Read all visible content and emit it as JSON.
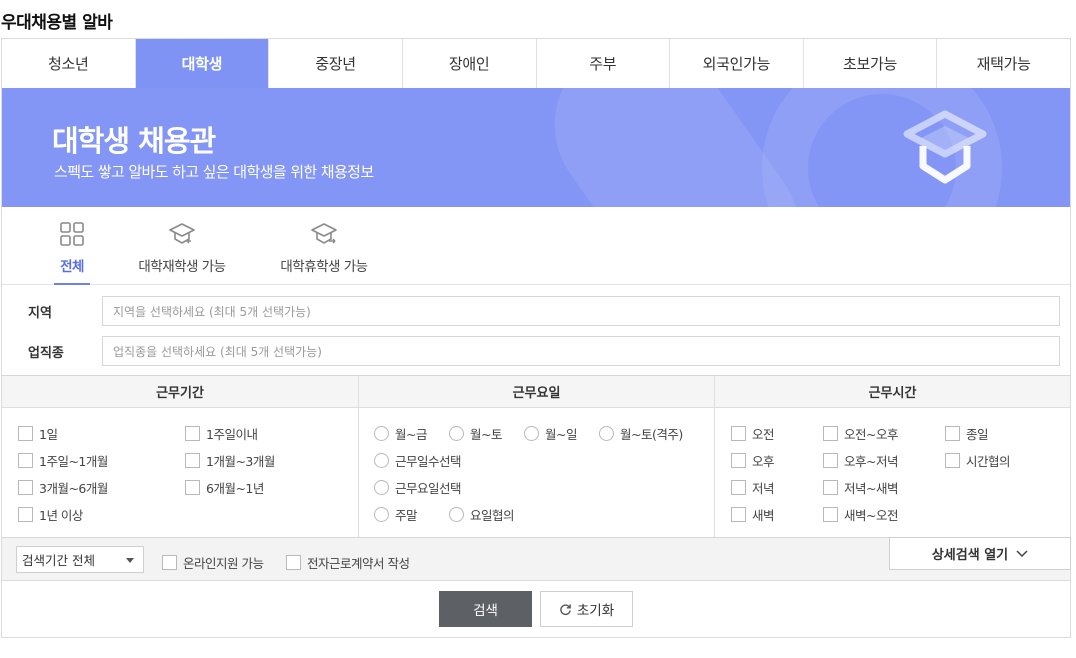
{
  "page_title": "우대채용별 알바",
  "tabs": [
    {
      "label": "청소년"
    },
    {
      "label": "대학생",
      "active": true
    },
    {
      "label": "중장년"
    },
    {
      "label": "장애인"
    },
    {
      "label": "주부"
    },
    {
      "label": "외국인가능"
    },
    {
      "label": "초보가능"
    },
    {
      "label": "재택가능"
    }
  ],
  "banner": {
    "title": "대학생 채용관",
    "subtitle": "스펙도 쌓고 알바도 하고 싶은 대학생을 위한 채용정보",
    "icon": "graduation-cap-icon"
  },
  "subtabs": [
    {
      "label": "전체",
      "icon": "grid-icon",
      "active": true
    },
    {
      "label": "대학재학생 가능",
      "icon": "graduation-cap-in-icon"
    },
    {
      "label": "대학휴학생 가능",
      "icon": "graduation-cap-out-icon"
    }
  ],
  "filters": {
    "region": {
      "label": "지역",
      "placeholder": "지역을 선택하세요 (최대 5개 선택가능)"
    },
    "job": {
      "label": "업직종",
      "placeholder": "업직종을 선택하세요 (최대 5개 선택가능)"
    }
  },
  "conditions": {
    "period": {
      "header": "근무기간",
      "options": [
        "1일",
        "1주일이내",
        "1주일~1개월",
        "1개월~3개월",
        "3개월~6개월",
        "6개월~1년",
        "1년 이상"
      ]
    },
    "days": {
      "header": "근무요일",
      "options": [
        "월~금",
        "월~토",
        "월~일",
        "월~토(격주)",
        "근무일수선택",
        "근무요일선택",
        "주말",
        "요일협의"
      ]
    },
    "time": {
      "header": "근무시간",
      "options": [
        "오전",
        "오전~오후",
        "종일",
        "오후",
        "오후~저녁",
        "시간협의",
        "저녁",
        "저녁~새벽",
        "새벽",
        "새벽~오전"
      ]
    }
  },
  "bottom_bar": {
    "period_select": "검색기간 전체",
    "online_apply": "온라인지원 가능",
    "e_contract": "전자근로계약서 작성",
    "detail_search": "상세검색 열기"
  },
  "actions": {
    "search": "검색",
    "reset": "초기화"
  },
  "colors": {
    "accent": "#7f93f4",
    "banner": "#8396f5",
    "search_button": "#5d6064",
    "active_subtab": "#5a6fdc"
  }
}
